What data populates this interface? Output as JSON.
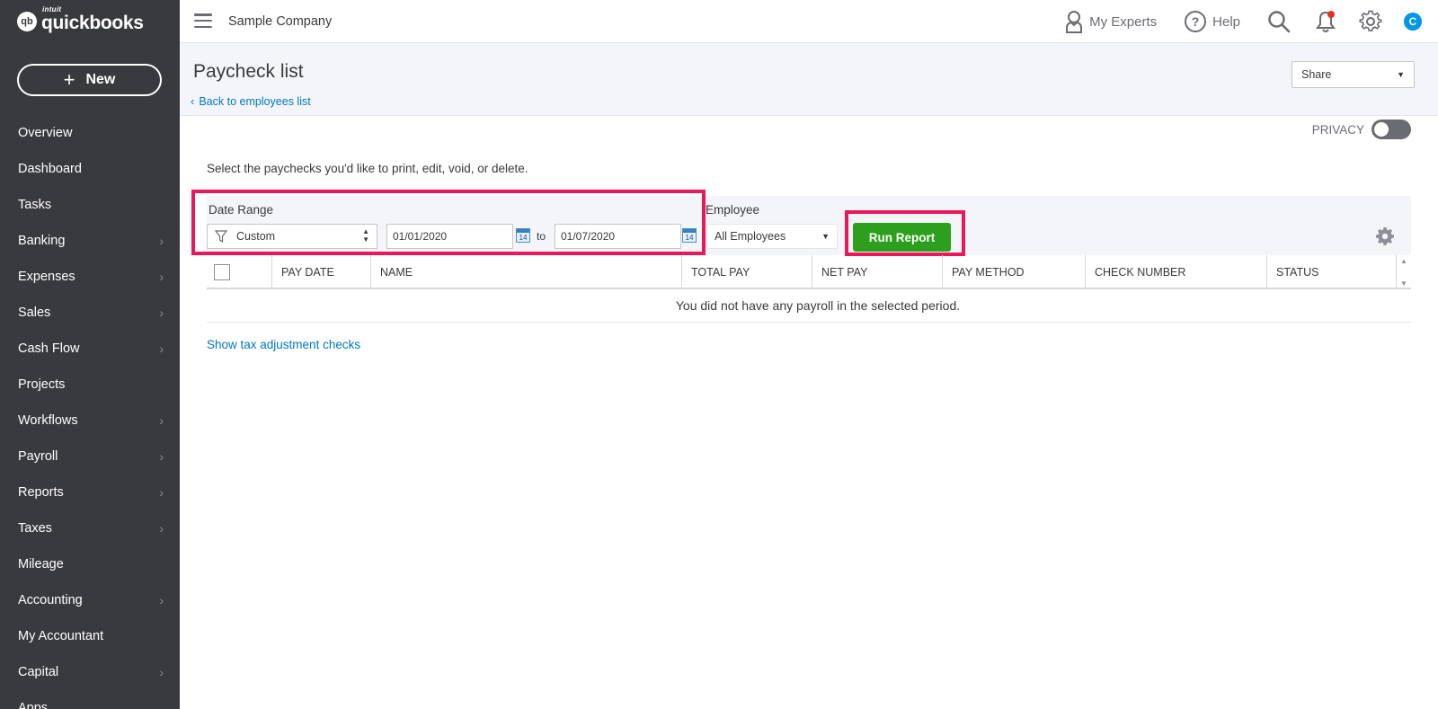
{
  "brand": {
    "intuit": "intuit",
    "name": "quickbooks",
    "mark": "qb"
  },
  "sidebar": {
    "new_label": "New",
    "items": [
      {
        "label": "Overview",
        "chevron": false
      },
      {
        "label": "Dashboard",
        "chevron": false
      },
      {
        "label": "Tasks",
        "chevron": false
      },
      {
        "label": "Banking",
        "chevron": true
      },
      {
        "label": "Expenses",
        "chevron": true
      },
      {
        "label": "Sales",
        "chevron": true
      },
      {
        "label": "Cash Flow",
        "chevron": true
      },
      {
        "label": "Projects",
        "chevron": false
      },
      {
        "label": "Workflows",
        "chevron": true
      },
      {
        "label": "Payroll",
        "chevron": true
      },
      {
        "label": "Reports",
        "chevron": true
      },
      {
        "label": "Taxes",
        "chevron": true
      },
      {
        "label": "Mileage",
        "chevron": false
      },
      {
        "label": "Accounting",
        "chevron": true
      },
      {
        "label": "My Accountant",
        "chevron": false
      },
      {
        "label": "Capital",
        "chevron": true
      },
      {
        "label": "Apps",
        "chevron": false
      }
    ]
  },
  "header": {
    "company": "Sample Company",
    "my_experts": "My Experts",
    "help": "Help",
    "avatar_initial": "C"
  },
  "page": {
    "title": "Paycheck list",
    "back_link": "Back to employees list",
    "share": "Share",
    "privacy": "PRIVACY",
    "instructions": "Select the paychecks you'd like to print, edit, void, or delete."
  },
  "filters": {
    "date_range_label": "Date Range",
    "date_range_value": "Custom",
    "start_date": "01/01/2020",
    "to": "to",
    "end_date": "01/07/2020",
    "calendar_day": "14",
    "employee_label": "Employee",
    "employee_value": "All Employees",
    "run_report": "Run Report"
  },
  "table": {
    "columns": [
      "PAY DATE",
      "NAME",
      "TOTAL PAY",
      "NET PAY",
      "PAY METHOD",
      "CHECK NUMBER",
      "STATUS"
    ],
    "empty_message": "You did not have any payroll in the selected period."
  },
  "footer_link": "Show tax adjustment checks",
  "colors": {
    "sidebar_bg": "#393a3d",
    "accent_green": "#2ca01c",
    "link_blue": "#0077c5",
    "highlight": "#e8185a",
    "notification_dot": "#e0301e"
  }
}
